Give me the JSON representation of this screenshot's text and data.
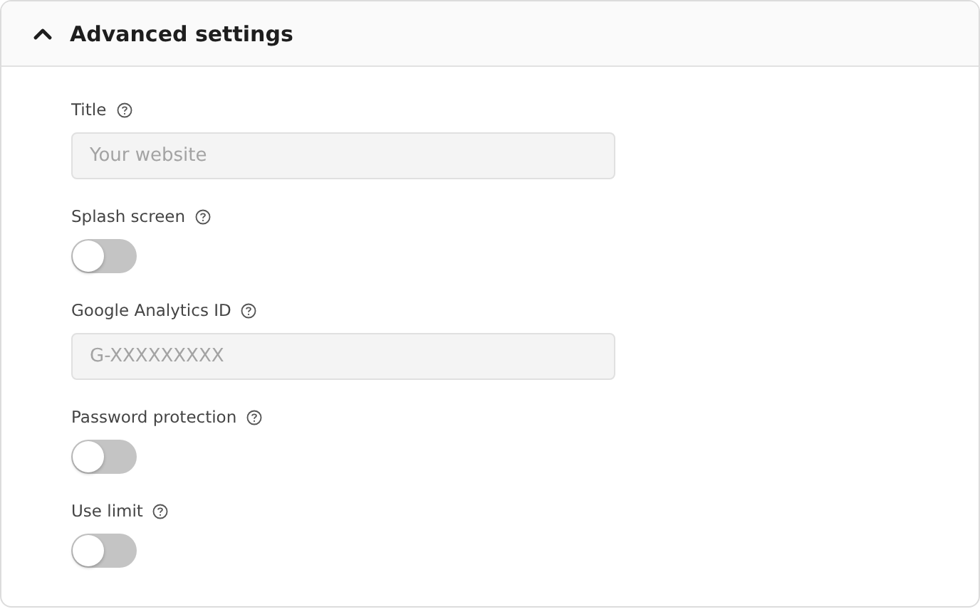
{
  "section": {
    "title": "Advanced settings",
    "expanded": true
  },
  "fields": [
    {
      "kind": "input",
      "label": "Title",
      "placeholder": "Your website"
    },
    {
      "kind": "toggle",
      "label": "Splash screen",
      "on": false
    },
    {
      "kind": "input",
      "label": "Google Analytics ID",
      "placeholder": "G-XXXXXXXXX"
    },
    {
      "kind": "toggle",
      "label": "Password protection",
      "on": false
    },
    {
      "kind": "toggle",
      "label": "Use limit",
      "on": false
    }
  ]
}
